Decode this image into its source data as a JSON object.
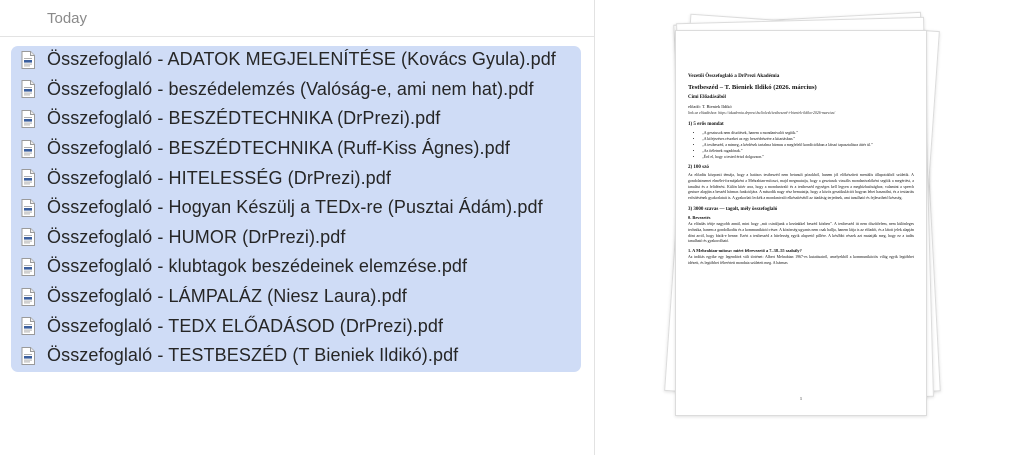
{
  "list": {
    "section_title": "Today",
    "files": [
      {
        "name": "Összefoglaló - ADATOK MEGJELENÍTÉSE (Kovács Gyula).pdf",
        "icon": "pdf-file-icon"
      },
      {
        "name": "Összefoglaló - beszédelemzés (Valóság-e, ami nem hat).pdf",
        "icon": "pdf-file-icon"
      },
      {
        "name": "Összefoglaló - BESZÉDTECHNIKA (DrPrezi).pdf",
        "icon": "pdf-file-icon"
      },
      {
        "name": "Összefoglaló - BESZÉDTECHNIKA (Ruff-Kiss Ágnes).pdf",
        "icon": "pdf-file-icon"
      },
      {
        "name": "Összefoglaló - HITELESSÉG (DrPrezi).pdf",
        "icon": "pdf-file-icon"
      },
      {
        "name": "Összefoglaló - Hogyan Készülj a TEDx-re (Pusztai Ádám).pdf",
        "icon": "pdf-file-icon"
      },
      {
        "name": "Összefoglaló - HUMOR (DrPrezi).pdf",
        "icon": "pdf-file-icon"
      },
      {
        "name": "Összefoglaló - klubtagok beszédeinek elemzése.pdf",
        "icon": "pdf-file-icon"
      },
      {
        "name": "Összefoglaló - LÁMPALÁZ (Niesz Laura).pdf",
        "icon": "pdf-file-icon"
      },
      {
        "name": "Összefoglaló - TEDX ELŐADÁSOD (DrPrezi).pdf",
        "icon": "pdf-file-icon"
      },
      {
        "name": "Összefoglaló - TESTBESZÉD (T Bieniek Ildikó).pdf",
        "icon": "pdf-file-icon"
      }
    ],
    "selection_color": "#cfdcf6"
  },
  "preview": {
    "institution": "Vezetői Összefoglaló a DrPrezi Akadémia",
    "title": "Testbeszéd – T. Bieniek Ildikó (2026. március)",
    "subtitle": "Cími Előadásából",
    "author": "előadó: T. Bieniek Ildikó",
    "link": "link az előadáshoz: https://akademia.drprezi.hu/kolesk/testbeszed-t-bieniek-ildiko-2026-marcius/",
    "section1_heading": "1) 5 erős mondat",
    "section1_bullets": [
      "„A gesztusok nem díszítések, hanem a mondanivalót segítik.”",
      "„A kifejezéses részeket az egy beszédrészére a kitartásban.”",
      "„A testbeszéd, a mimeg, a kérdések tartalma hármas a megfelelő kondíciókban a látszó tapasztalásra áttér ül.”",
      "„Az ítéletnek ragadónak.”",
      "„Érd el, hogy a tested értsd dolgozzon.”"
    ],
    "section2_heading": "2) 100 szó",
    "section2_text": "Az előadás központi témája, hogy a hatásos testbeszéd nem betanult pózokból, hanem jól előkészített mentális állapotokból születik. A gondolatmenet elmélet-formájaként a Mehrabian-mítoszt, majd megmutatja, hogy a gesztusok vizuális mondanivalóként segítik a megértést, a tanulást és a felidézést. Külön kitér arra, hogy a mondanivaló és a testbeszéd egységes kell legyen a megbízhatósághoz; valamint a speech gesture alapján a beszéd hármas funkciójára. A második nagy rész bemutatja, hogy a közös gesztikulációt hogyan lehet használni, és a testtartás erősítésének gyakorlatait is. A gyakorlati leckék a mondanivaló elkészítésétől az átadásig terjednek, ami tanulható és fejleszthető készség.",
    "section3_heading": "3) 3000 szavas — tagolt, mély összefoglaló",
    "section3_sub": "0. Bevezetés",
    "section3_text": "Az előadás téttje nagyobb annál, mint hogy „mit csináljunk a kezünkkel beszéd közben”. A testbeszéd itt nem díszítőelem, nem különleges technika, hanem a gondolkodás és a kommunikáció része. A közönség ugyanis nem csak hallja, hanem látja is az előadót, és a látott jelek alapján dönt arról, hogy bízik-e benne. Ezért a testbeszéd a hitelesség egyik alapvető pillére. A későbbi részek azt mutatják meg, hogy ez a tudás tanulható és gyakorolható.",
    "section4_heading": "1. A Mehrabian-mítosz: miért félrevezető a 7–38–55 szabály?",
    "section4_text": "Az indítás egyike egy legendává vált történet: Albert Mehrabian 1967-es kutatásairól, amelyekből a kommunikációs világ egyik legtöbbet idézett, és legtöbbet félreértett mondata született meg. A hármas",
    "page_number": "1"
  }
}
